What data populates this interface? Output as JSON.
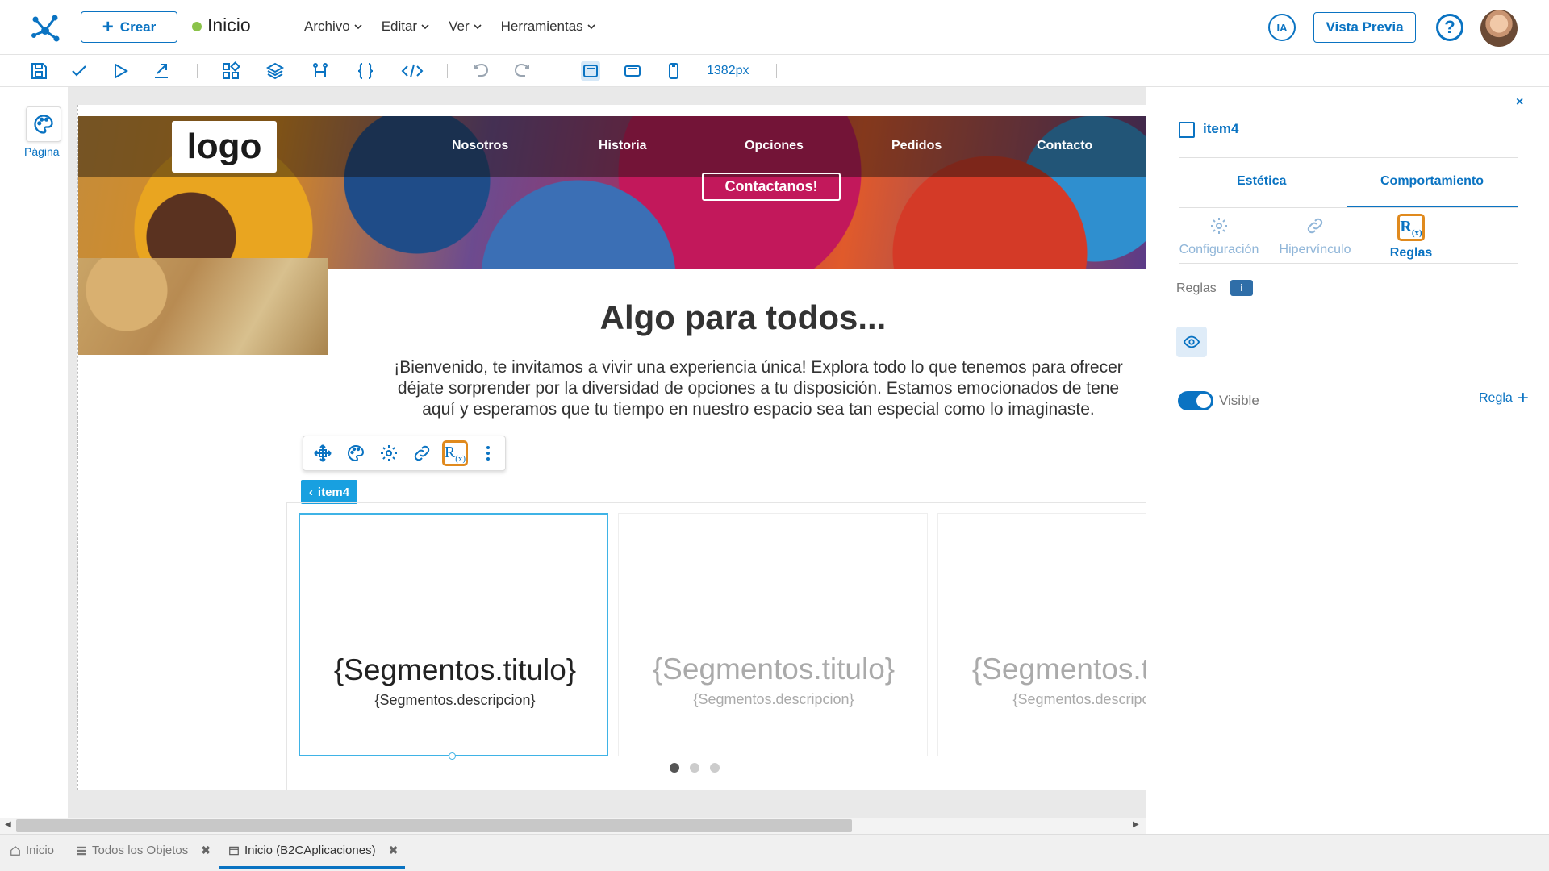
{
  "header": {
    "create_label": "Crear",
    "page_name": "Inicio",
    "menu": [
      "Archivo",
      "Editar",
      "Ver",
      "Herramientas"
    ],
    "ia_label": "IA",
    "preview_label": "Vista Previa",
    "help_label": "?"
  },
  "toolbar": {
    "width_readout": "1382px",
    "icons": [
      "save-icon",
      "check-icon",
      "play-icon",
      "publish-icon",
      "components-icon",
      "layers-icon",
      "flow-icon",
      "braces-icon",
      "code-icon",
      "undo-icon",
      "redo-icon",
      "desktop-icon",
      "tablet-icon",
      "mobile-icon"
    ]
  },
  "left_rail": {
    "page_label": "Página"
  },
  "site": {
    "logo": "logo",
    "nav": [
      "Nosotros",
      "Historia",
      "Opciones",
      "Pedidos",
      "Contacto"
    ],
    "contact_button": "Contactanos!",
    "title": "Algo para todos...",
    "description_lines": [
      "¡Bienvenido, te invitamos a vivir una experiencia única! Explora todo lo que tenemos para ofrecer",
      "déjate sorprender por la diversidad de opciones a tu disposición. Estamos emocionados de tene",
      "aquí y esperamos que tu tiempo en nuestro espacio sea tan especial como lo imaginaste."
    ]
  },
  "component": {
    "tag": "item4",
    "toolbar_icons": [
      "move-icon",
      "palette-icon",
      "settings-icon",
      "link-icon",
      "rules-icon",
      "more-icon"
    ],
    "rules_glyph": "R",
    "rules_glyph_sub": "(x)"
  },
  "carousel": {
    "slides": [
      {
        "title": "{Segmentos.titulo}",
        "description": "{Segmentos.descripcion}"
      },
      {
        "title": "{Segmentos.titulo}",
        "description": "{Segmentos.descripcion}"
      },
      {
        "title": "{Segmentos.titulo}",
        "description": "{Segmentos.descripcion}"
      }
    ],
    "active_dot": 0
  },
  "panel": {
    "close_label": "×",
    "element_name": "item4",
    "tabs": [
      "Estética",
      "Comportamiento"
    ],
    "active_tab": "Comportamiento",
    "subtabs": [
      "Configuración",
      "Hipervínculo",
      "Reglas"
    ],
    "active_subtab": "Reglas",
    "rules_label": "Reglas",
    "info_label": "i",
    "visible_label": "Visible",
    "visible_on": true,
    "rule_link": "Regla"
  },
  "bottom_tabs": [
    {
      "label": "Inicio",
      "closable": false
    },
    {
      "label": "Todos los Objetos",
      "closable": true
    },
    {
      "label": "Inicio (B2CAplicaciones)",
      "closable": true,
      "active": true
    }
  ],
  "colors": {
    "accent": "#0a73c2",
    "highlight": "#e08a1e",
    "status": "#8bc34a"
  }
}
